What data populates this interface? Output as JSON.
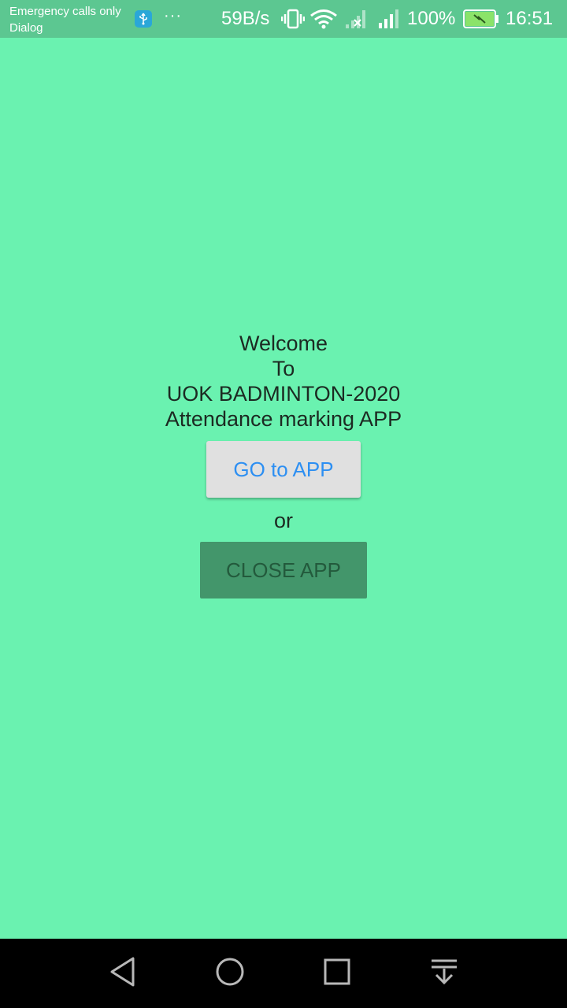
{
  "status_bar": {
    "carrier_line1": "Emergency calls only",
    "carrier_line2": "Dialog",
    "more": "···",
    "net_speed": "59B/s",
    "battery_percent": "100%",
    "time": "16:51",
    "icons": [
      "usb-icon",
      "more-icon",
      "vibrate-icon",
      "wifi-icon",
      "signal-no-sim-icon",
      "signal-icon",
      "battery-charging-icon"
    ]
  },
  "main": {
    "welcome_lines": [
      "Welcome",
      "To",
      "UOK BADMINTON-2020",
      "Attendance marking APP"
    ],
    "go_button_label": "GO to APP",
    "or_text": "or",
    "close_button_label": "CLOSE APP"
  },
  "nav_bar": {
    "icons": [
      "back-icon",
      "home-icon",
      "recents-icon",
      "notification-drawer-icon"
    ]
  },
  "colors": {
    "background": "#6af2b0",
    "status_bar": "#5cc791",
    "go_button_bg": "#e0e0e0",
    "go_button_text": "#2d8ff2",
    "close_button_bg": "#43966b",
    "close_button_text": "#235a3c"
  }
}
